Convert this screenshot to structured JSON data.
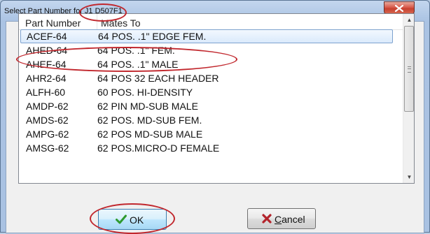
{
  "dialog": {
    "title": "Select Part Number for J1 D507F1",
    "close_symbol": "✕"
  },
  "list": {
    "columns": [
      "Part Number",
      "Mates To"
    ],
    "rows": [
      {
        "part": "ACEF-64",
        "mates": "64 POS. .1\" EDGE FEM.",
        "selected": true
      },
      {
        "part": "AHED-64",
        "mates": "64 POS. .1\" FEM."
      },
      {
        "part": "AHEF-64",
        "mates": "64 POS. .1\" MALE"
      },
      {
        "part": "AHR2-64",
        "mates": "64 POS 32 EACH HEADER"
      },
      {
        "part": "ALFH-60",
        "mates": "60 POS. HI-DENSITY"
      },
      {
        "part": "AMDP-62",
        "mates": "62 PIN MD-SUB MALE"
      },
      {
        "part": "AMDS-62",
        "mates": "62 POS. MD-SUB FEM."
      },
      {
        "part": "AMPG-62",
        "mates": "62 POS MD-SUB MALE"
      },
      {
        "part": "AMSG-62",
        "mates": "62 POS.MICRO-D FEMALE"
      }
    ]
  },
  "buttons": {
    "ok": {
      "label": "OK",
      "icon": "checkmark-icon",
      "color": "#2e9a2e"
    },
    "cancel": {
      "label_underlined": "C",
      "label_rest": "ancel",
      "icon": "x-icon",
      "color": "#b3232b"
    }
  },
  "annotation_color": "#c1272d"
}
